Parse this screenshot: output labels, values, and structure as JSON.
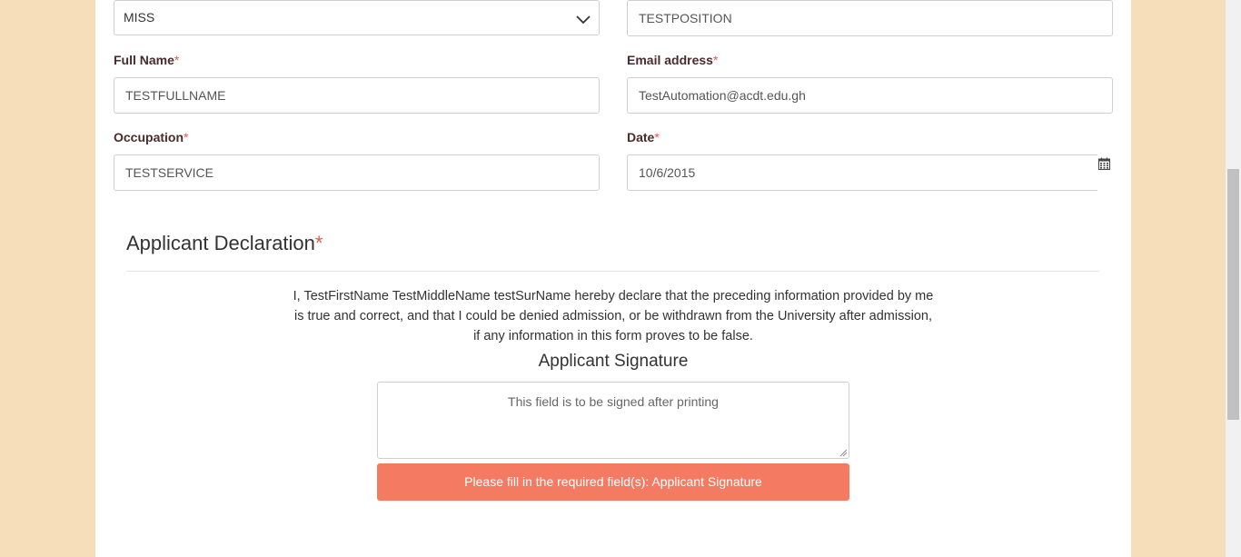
{
  "form": {
    "title_select": {
      "value": "MISS"
    },
    "position": {
      "value": "TESTPOSITION"
    },
    "full_name": {
      "label": "Full Name",
      "required": "*",
      "value": "TESTFULLNAME"
    },
    "email": {
      "label": "Email address",
      "required": "*",
      "value": "TestAutomation@acdt.edu.gh"
    },
    "occupation": {
      "label": "Occupation",
      "required": "*",
      "value": "TESTSERVICE"
    },
    "date": {
      "label": "Date",
      "required": "*",
      "value": "10/6/2015"
    }
  },
  "declaration": {
    "title": "Applicant Declaration",
    "required": "*",
    "text": "I, TestFirstName TestMiddleName testSurName hereby declare that the preceding information provided by me is true and correct, and that I could be denied admission, or be withdrawn from the University after admission, if any information in this form proves to be false.",
    "signature_title": "Applicant Signature",
    "signature_placeholder": "This field is to be signed after printing",
    "error_message": "Please fill in the required field(s): Applicant Signature"
  },
  "icons": {
    "select_arrow": "chevron-down-icon",
    "date_picker": "calendar-icon",
    "resize": "resize-grip-icon"
  },
  "colors": {
    "background": "#f5deb9",
    "label": "#4a2a2a",
    "required": "#e05a4e",
    "error": "#f47a62"
  }
}
